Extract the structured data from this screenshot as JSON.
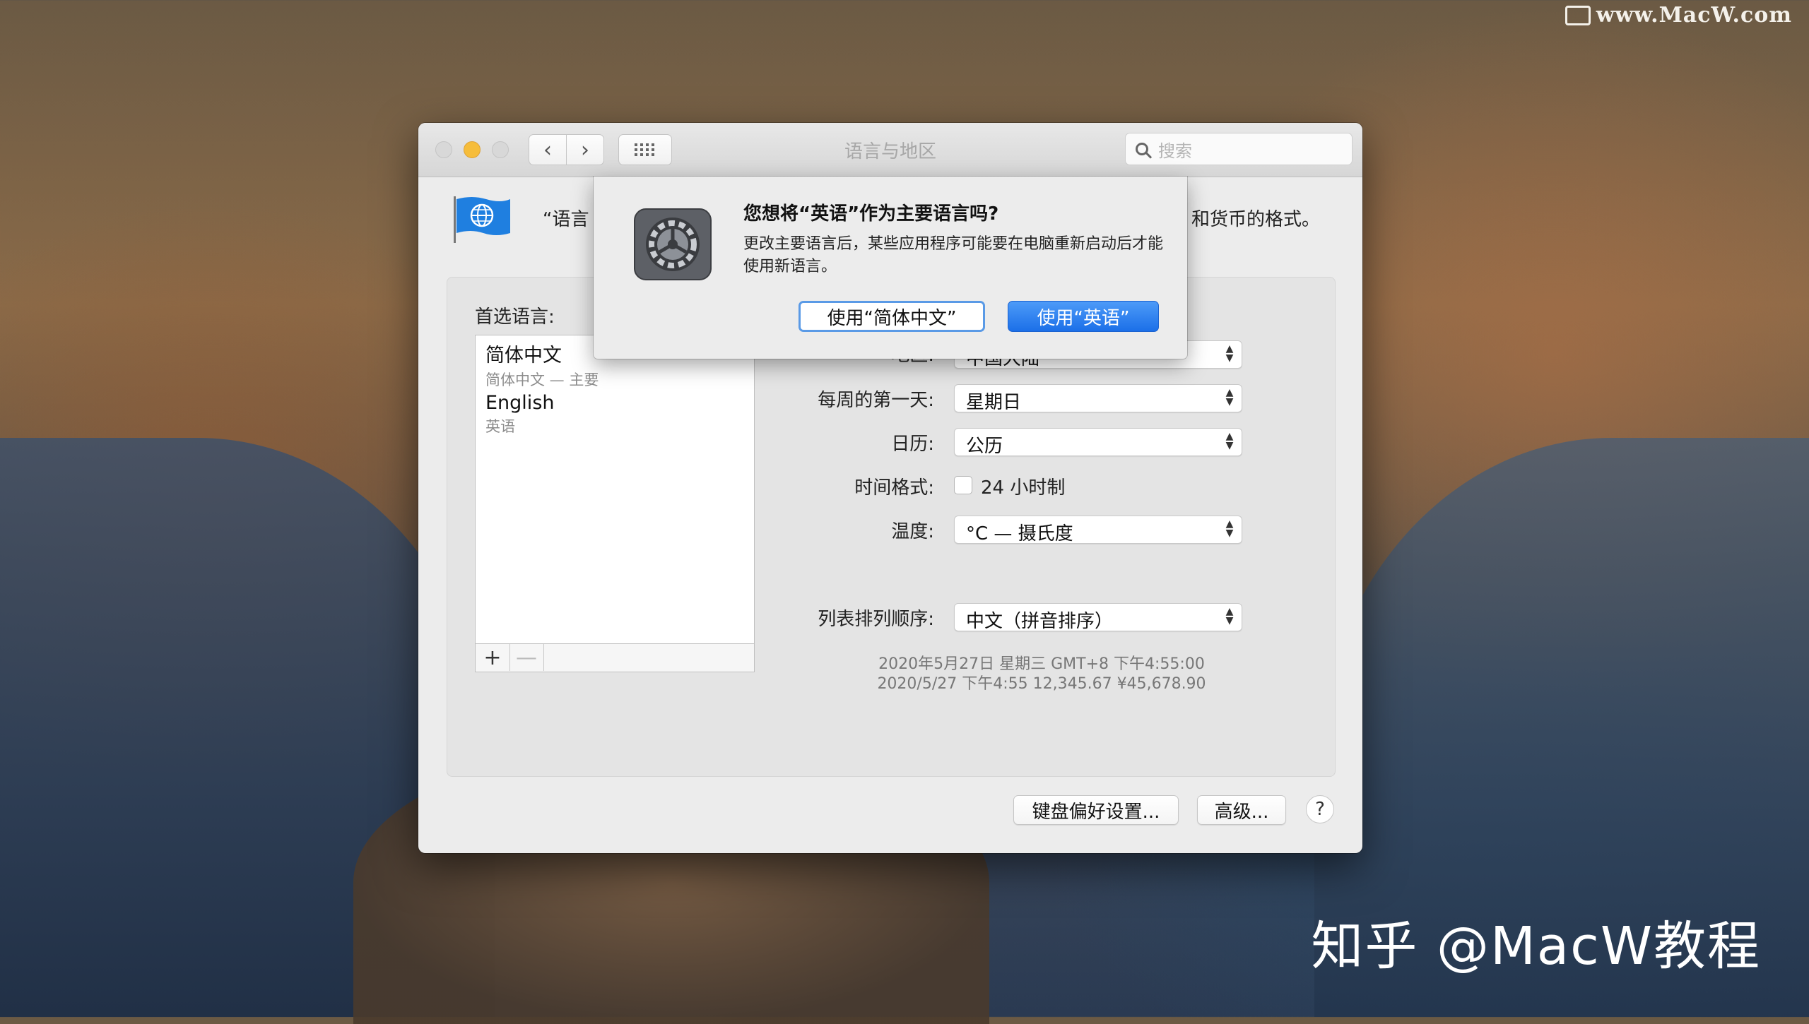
{
  "watermarks": {
    "top": "www.MacW.com",
    "bottom": "知乎 @MacW教程"
  },
  "window": {
    "title": "语言与地区",
    "search_placeholder": "搜索"
  },
  "header": {
    "description_start": "“语言",
    "description_end": "和货币的格式。"
  },
  "preferred": {
    "label": "首选语言:",
    "languages": [
      {
        "name": "简体中文",
        "sub": "简体中文 — 主要"
      },
      {
        "name": "English",
        "sub": "英语"
      }
    ],
    "add_label": "+",
    "remove_label": "—"
  },
  "settings": {
    "region_label": "地区:",
    "region_value": "中国大陆",
    "first_day_label": "每周的第一天:",
    "first_day_value": "星期日",
    "calendar_label": "日历:",
    "calendar_value": "公历",
    "time_format_label": "时间格式:",
    "time_format_check": "24 小时制",
    "temperature_label": "温度:",
    "temperature_value": "°C — 摄氏度",
    "sort_label": "列表排列顺序:",
    "sort_value": "中文（拼音排序）",
    "sample_line1": "2020年5月27日 星期三 GMT+8 下午4:55:00",
    "sample_line2": "2020/5/27 下午4:55      12,345.67      ¥45,678.90"
  },
  "footer": {
    "keyboard_button": "键盘偏好设置...",
    "advanced_button": "高级...",
    "help_button": "?"
  },
  "dialog": {
    "title": "您想将“英语”作为主要语言吗?",
    "body": "更改主要语言后，某些应用程序可能要在电脑重新启动后才能使用新语言。",
    "cancel_button": "使用“简体中文”",
    "confirm_button": "使用“英语”"
  },
  "colors": {
    "accent": "#1b6fe8",
    "focus_ring": "#5a9ae6",
    "minimize": "#f6bd3b"
  }
}
